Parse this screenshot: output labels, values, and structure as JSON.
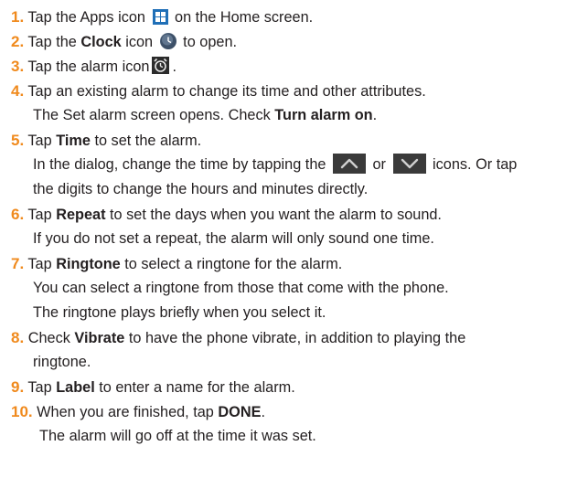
{
  "steps": [
    {
      "num": "1.",
      "text_before": "Tap the Apps icon",
      "icon": "apps-icon",
      "text_after": "on the Home screen."
    },
    {
      "num": "2.",
      "text_before": "Tap the",
      "bold": "Clock",
      "text_mid": "icon",
      "icon": "clock-icon",
      "text_after": "to open."
    },
    {
      "num": "3.",
      "text_before": "Tap the alarm icon",
      "icon": "alarm-clock-icon",
      "text_after": "."
    },
    {
      "num": "4.",
      "text": "Tap an existing alarm to change its time and other attributes.",
      "cont_before": "The Set alarm screen opens. Check",
      "cont_bold": "Turn alarm on",
      "cont_after": "."
    },
    {
      "num": "5.",
      "text_before": "Tap",
      "bold": "Time",
      "text_after": "to set the alarm.",
      "cont1_before": "In the dialog, change the time by tapping the",
      "icon_up": "chevron-up-icon",
      "cont1_mid": "or",
      "icon_down": "chevron-down-icon",
      "cont1_after": "icons. Or tap",
      "cont2": "the digits to change the hours and minutes directly."
    },
    {
      "num": "6.",
      "text_before": "Tap",
      "bold": "Repeat",
      "text_after": "to set the days when you want the alarm to sound.",
      "cont": "If you do not set a repeat, the alarm will only sound one time."
    },
    {
      "num": "7.",
      "text_before": "Tap",
      "bold": "Ringtone",
      "text_after": "to select a ringtone for the alarm.",
      "cont1": "You can select a ringtone from those that come with the phone.",
      "cont2": "The ringtone plays briefly when you select it."
    },
    {
      "num": "8.",
      "text_before": "Check",
      "bold": "Vibrate",
      "text_after": "to have the phone vibrate, in addition to playing the",
      "cont": "ringtone."
    },
    {
      "num": "9.",
      "text_before": "Tap",
      "bold": "Label",
      "text_after": "to enter a name for the alarm."
    },
    {
      "num": "10.",
      "text_before": "When you are finished, tap",
      "bold": "DONE",
      "text_after": ".",
      "cont": "The alarm will go off at the time it was set."
    }
  ],
  "colors": {
    "step_number": "#f08a1d",
    "text": "#231f20",
    "apps_icon": "#1f6fb7"
  }
}
